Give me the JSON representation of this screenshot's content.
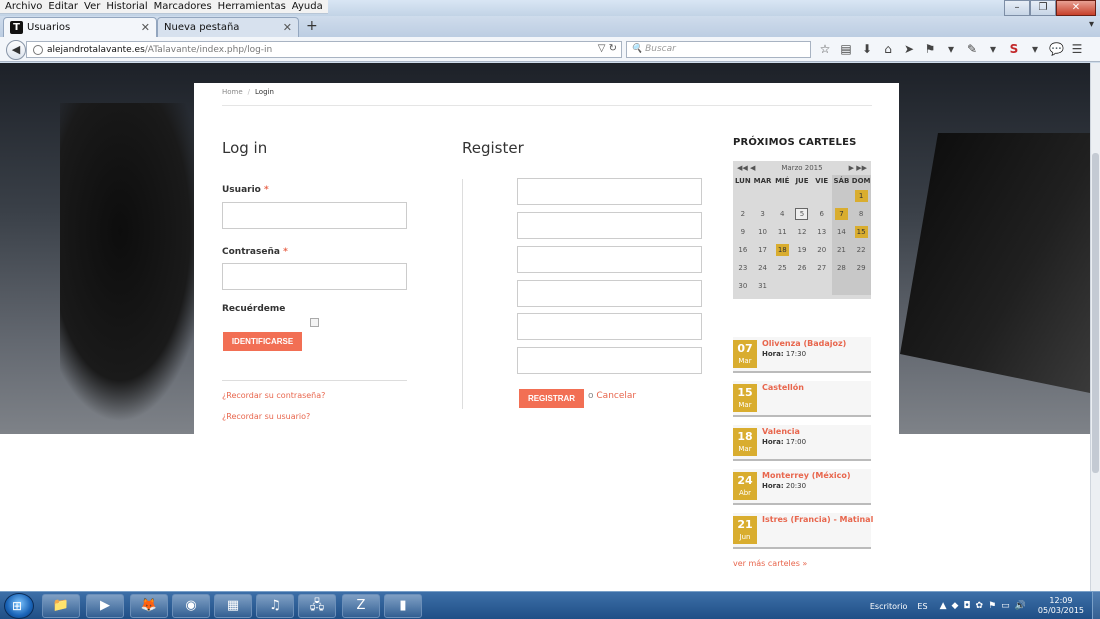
{
  "window": {
    "menu": [
      "Archivo",
      "Editar",
      "Ver",
      "Historial",
      "Marcadores",
      "Herramientas",
      "Ayuda"
    ],
    "controls": [
      "–",
      "❐",
      "✕"
    ]
  },
  "tabs": [
    {
      "label": "Usuarios",
      "favicon": "T",
      "active": true
    },
    {
      "label": "Nueva pestaña",
      "active": false
    }
  ],
  "navbar": {
    "url_host": "alejandrotalavante.es",
    "url_path": "/ATalavante/index.php/log-in",
    "search_placeholder": "Buscar"
  },
  "breadcrumb": {
    "home": "Home",
    "sep": "/",
    "current": "Login"
  },
  "login": {
    "title": "Log in",
    "username_label": "Usuario",
    "password_label": "Contraseña",
    "required_mark": "*",
    "remember_label": "Recuérdeme",
    "submit_label": "IDENTIFICARSE",
    "forgot_password": "¿Recordar su contraseña?",
    "forgot_username": "¿Recordar su usuario?"
  },
  "register": {
    "title": "Register",
    "submit_label": "REGISTRAR",
    "or_text": "o",
    "cancel_label": "Cancelar"
  },
  "sidebar": {
    "title": "PRÓXIMOS CARTELES",
    "calendar": {
      "prev": "◀◀ ◀",
      "next": "▶ ▶▶",
      "month": "Marzo 2015",
      "dow": [
        "LUN",
        "MAR",
        "MIÉ",
        "JUE",
        "VIE",
        "SÁB",
        "DOM"
      ],
      "weeks": [
        [
          "",
          "",
          "",
          "",
          "",
          "",
          "1"
        ],
        [
          "2",
          "3",
          "4",
          "5",
          "6",
          "7",
          "8"
        ],
        [
          "9",
          "10",
          "11",
          "12",
          "13",
          "14",
          "15"
        ],
        [
          "16",
          "17",
          "18",
          "19",
          "20",
          "21",
          "22"
        ],
        [
          "23",
          "24",
          "25",
          "26",
          "27",
          "28",
          "29"
        ],
        [
          "30",
          "31",
          "",
          "",
          "",
          "",
          ""
        ]
      ],
      "event_days": [
        "1",
        "7",
        "15",
        "18"
      ],
      "today": "5"
    },
    "events": [
      {
        "day": "07",
        "month": "Mar",
        "title": "Olivenza (Badajoz)",
        "time_label": "Hora:",
        "time": "17:30"
      },
      {
        "day": "15",
        "month": "Mar",
        "title": "Castellón",
        "time_label": "",
        "time": ""
      },
      {
        "day": "18",
        "month": "Mar",
        "title": "Valencia",
        "time_label": "Hora:",
        "time": "17:00"
      },
      {
        "day": "24",
        "month": "Abr",
        "title": "Monterrey (México)",
        "time_label": "Hora:",
        "time": "20:30"
      },
      {
        "day": "21",
        "month": "Jun",
        "title": "Istres (Francia) - Matinal",
        "time_label": "",
        "time": ""
      }
    ],
    "more_link": "ver más carteles »"
  },
  "taskbar": {
    "desktop_label": "Escritorio",
    "lang": "ES",
    "time": "12:09",
    "date": "05/03/2015"
  },
  "colors": {
    "accent": "#f26f54",
    "event_gold": "#d9ad2f"
  }
}
